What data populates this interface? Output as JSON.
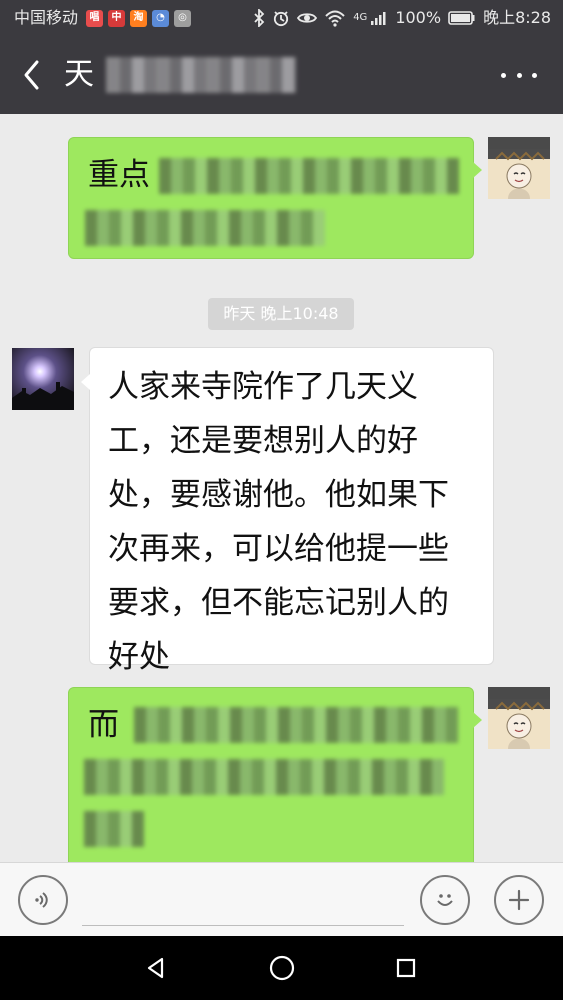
{
  "status_bar": {
    "carrier": "中国移动",
    "battery": "100%",
    "time": "晚上8:28",
    "network_label": "4G",
    "mini_apps": [
      {
        "icon": "music-app-icon",
        "label": "唱",
        "color": "#e84d4d"
      },
      {
        "icon": "bank-app-icon",
        "label": "中",
        "color": "#d63a3a"
      },
      {
        "icon": "taobao-app-icon",
        "label": "淘",
        "color": "#ff7f1f"
      },
      {
        "icon": "browser-app-icon",
        "label": "◔",
        "color": "#5b8bd8"
      },
      {
        "icon": "share-app-icon",
        "label": "◎",
        "color": "#9e9e9e"
      }
    ],
    "icons": [
      "bluetooth-icon",
      "alarm-icon",
      "eye-icon",
      "wifi-icon",
      "signal-icon",
      "battery-icon"
    ]
  },
  "header": {
    "title": "天",
    "back_icon": "chevron-left-icon",
    "more_icon": "more-icon"
  },
  "chat": {
    "timestamp": "昨天 晚上10:48",
    "messages": [
      {
        "sender": "self",
        "text": "重点"
      },
      {
        "sender": "other",
        "text": "人家来寺院作了几天义工，还是要想别人的好处，要感谢他。他如果下次再来，可以给他提一些要求，但不能忘记别人的好处"
      },
      {
        "sender": "self",
        "text": "而"
      }
    ]
  },
  "input_bar": {
    "voice_icon": "voice-icon",
    "emoji_icon": "emoji-icon",
    "plus_icon": "plus-icon",
    "placeholder": ""
  },
  "nav_bar": {
    "back_icon": "triangle-back-icon",
    "home_icon": "circle-home-icon",
    "recent_icon": "square-recent-icon"
  },
  "colors": {
    "header_bg": "#3b3a3f",
    "chat_bg": "#ebebeb",
    "green_bubble": "#9ee85f",
    "white_bubble": "#ffffff",
    "timestamp_bg": "#d5d5d5"
  }
}
